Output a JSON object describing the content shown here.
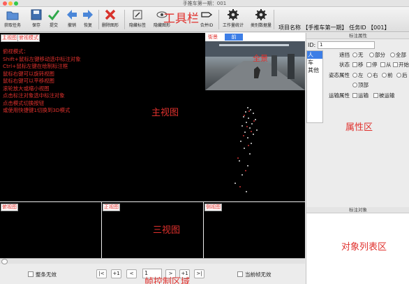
{
  "window": {
    "title": "手推车第一期：001"
  },
  "toolbar": {
    "buttons": [
      {
        "label": "获取任务"
      },
      {
        "label": "保存"
      },
      {
        "label": "提交"
      },
      {
        "label": "撤销"
      },
      {
        "label": "恢复"
      },
      {
        "label": "删除图形"
      },
      {
        "label": "隐藏标签"
      },
      {
        "label": "隐藏图形"
      },
      {
        "label": "合并ID"
      },
      {
        "label": "工作量统计"
      },
      {
        "label": "类别数据量"
      }
    ],
    "overlay": "工具栏",
    "project_label": "项目名称",
    "project_value": "【手推车第一期】",
    "task_label": "任务ID",
    "task_value": "【001】"
  },
  "main": {
    "tabs": [
      "主视图",
      "俯视模式"
    ],
    "help_lines": [
      "俯视模式：",
      "Shift+鼠标左键移动选中标注对象",
      "Ctrl+鼠标左键在绘制标注框",
      "鼠标右键可以旋转视图",
      "鼠标右键可以平移视图",
      "滚轮放大或缩小视图",
      "点击标注对象选中标注对象",
      "点击模式切换按钮",
      "或使用快捷键1切换到3D模式"
    ],
    "overlay": "主视图",
    "camera": {
      "tabs": [
        "街景",
        "前"
      ],
      "overlay": "全景"
    }
  },
  "views": {
    "labels": [
      "俯视图",
      "正视图",
      "侧视图"
    ],
    "overlay": "三视图"
  },
  "control": {
    "whole_invalid": "整条无效",
    "current_invalid": "当前帧无效",
    "nav": [
      "|<",
      "+1",
      "<",
      ">",
      "+1",
      ">|"
    ],
    "frame_value": "1",
    "overlay": "帧控制区域"
  },
  "right": {
    "attr_header": "标注属性",
    "id_label": "ID:",
    "id_value": "1",
    "categories": [
      "人",
      "车",
      "其他"
    ],
    "attributes": [
      {
        "label": "遮挡",
        "options": [
          "无",
          "部分",
          "全部"
        ]
      },
      {
        "label": "状态",
        "options": [
          "移",
          "停",
          "从",
          "开始"
        ]
      },
      {
        "label": "姿态属性",
        "options": [
          "左",
          "右",
          "前",
          "后"
        ]
      },
      {
        "label": "",
        "options": [
          "顶部"
        ]
      },
      {
        "label": "运输属性",
        "options": [
          "运输",
          "被运输"
        ]
      }
    ],
    "overlay_attr": "属性区",
    "obj_header": "标注对象",
    "overlay_obj": "对象列表区"
  }
}
